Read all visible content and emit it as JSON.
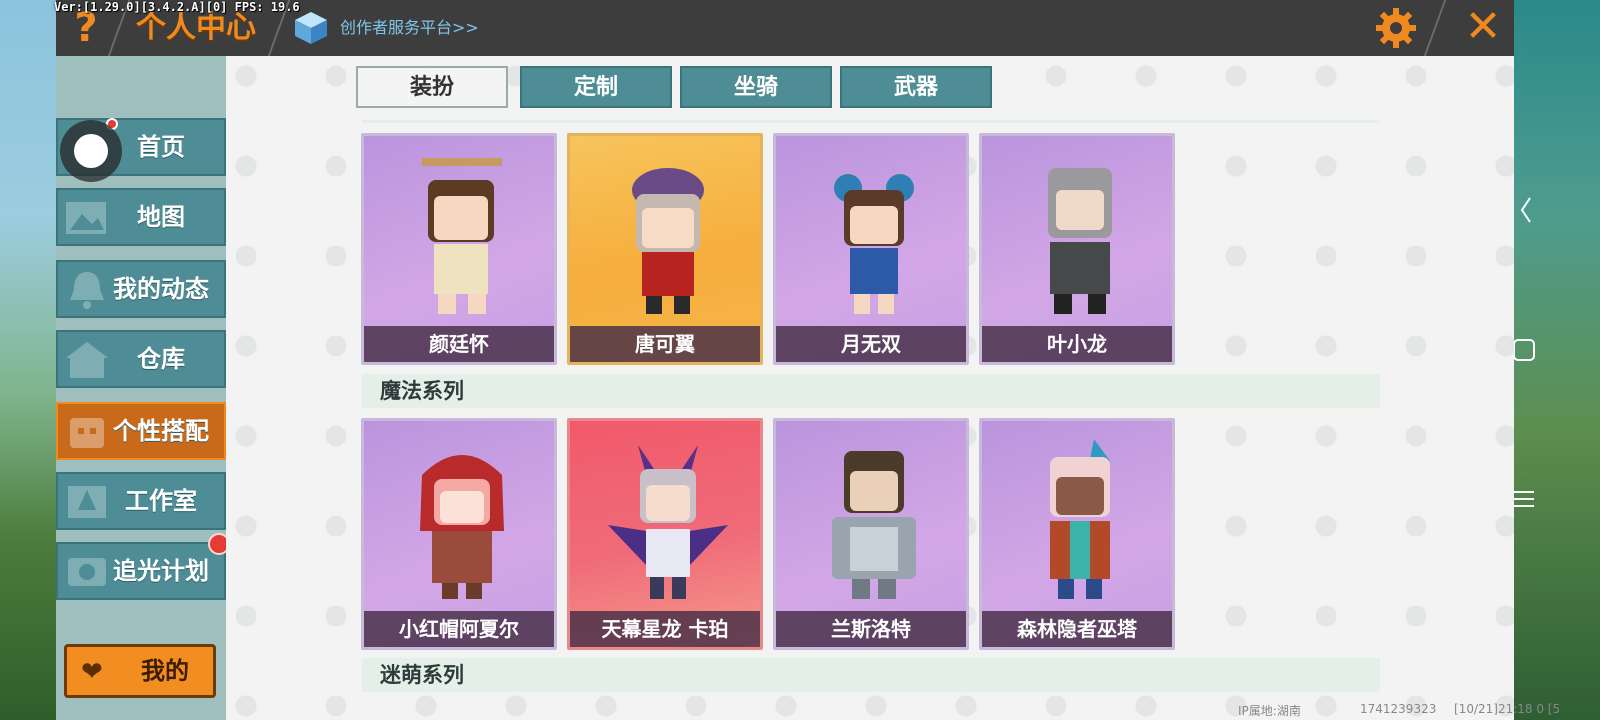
{
  "version_overlay": "Ver:[1.29.0][3.4.2.A][0] FPS: 19.6",
  "header": {
    "title": "个人中心",
    "creator_link": "创作者服务平台>>"
  },
  "tabs": [
    "装扮",
    "定制",
    "坐骑",
    "武器"
  ],
  "sidebar": {
    "items": [
      {
        "label": "首页",
        "icon": "home-icon",
        "active": false,
        "badge": true
      },
      {
        "label": "地图",
        "icon": "map-icon",
        "active": false,
        "badge": false
      },
      {
        "label": "我的动态",
        "icon": "bell-icon",
        "active": false,
        "badge": false
      },
      {
        "label": "仓库",
        "icon": "warehouse-icon",
        "active": false,
        "badge": false
      },
      {
        "label": "个性搭配",
        "icon": "outfit-icon",
        "active": true,
        "badge": false
      },
      {
        "label": "工作室",
        "icon": "studio-icon",
        "active": false,
        "badge": false
      },
      {
        "label": "追光计划",
        "icon": "lightchase-icon",
        "active": false,
        "badge": true
      }
    ],
    "mine_button": "我的"
  },
  "rows": [
    {
      "series": "",
      "cards": [
        {
          "name": "颜廷怀",
          "theme": "purple"
        },
        {
          "name": "唐可翼",
          "theme": "gold"
        },
        {
          "name": "月无双",
          "theme": "purple"
        },
        {
          "name": "叶小龙",
          "theme": "purple"
        }
      ]
    },
    {
      "series": "魔法系列",
      "cards": [
        {
          "name": "小红帽阿夏尔",
          "theme": "purple"
        },
        {
          "name": "天幕星龙 卡珀",
          "theme": "red"
        },
        {
          "name": "兰斯洛特",
          "theme": "purple"
        },
        {
          "name": "森林隐者巫塔",
          "theme": "purple"
        }
      ]
    },
    {
      "series": "迷萌系列",
      "cards": []
    }
  ],
  "footer": {
    "ip_location": "IP属地:湖南",
    "uid": "1741239323",
    "timestamp": "[10/21]21:18 0 [5"
  },
  "colors": {
    "accent": "#f08a1e",
    "nav_teal": "#4e8d95",
    "header_bg": "#3d3d3d"
  }
}
